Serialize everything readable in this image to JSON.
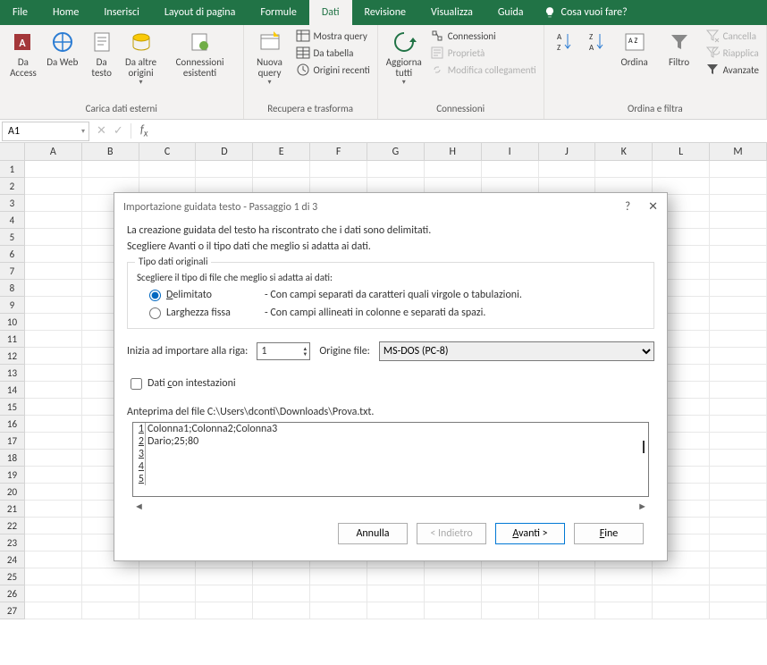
{
  "tabs": [
    "File",
    "Home",
    "Inserisci",
    "Layout di pagina",
    "Formule",
    "Dati",
    "Revisione",
    "Visualizza",
    "Guida"
  ],
  "active_tab": "Dati",
  "tell_me": "Cosa vuoi fare?",
  "ribbon": {
    "group1": {
      "label": "Carica dati esterni",
      "btns": [
        "Da Access",
        "Da Web",
        "Da testo",
        "Da altre origini",
        "Connessioni esistenti"
      ]
    },
    "group2": {
      "label": "Recupera e trasforma",
      "new_query": "Nuova query",
      "small": [
        "Mostra query",
        "Da tabella",
        "Origini recenti"
      ]
    },
    "group3": {
      "label": "Connessioni",
      "refresh": "Aggiorna tutti",
      "small": [
        "Connessioni",
        "Proprietà",
        "Modifica collegamenti"
      ]
    },
    "group4": {
      "label": "Ordina e filtra",
      "sort": "Ordina",
      "filter": "Filtro",
      "small": [
        "Cancella",
        "Riapplica",
        "Avanzate"
      ]
    }
  },
  "namebox": "A1",
  "cols": [
    "A",
    "B",
    "C",
    "D",
    "E",
    "F",
    "G",
    "H",
    "I",
    "J",
    "K",
    "L",
    "M"
  ],
  "rowcount": 27,
  "dialog": {
    "title": "Importazione guidata testo - Passaggio 1 di 3",
    "line1": "La creazione guidata del testo ha riscontrato che i dati sono delimitati.",
    "line2": "Scegliere Avanti o il tipo dati che meglio si adatta ai dati.",
    "fieldset": "Tipo dati originali",
    "fs_hint": "Scegliere il tipo di file che meglio si adatta ai dati:",
    "opt_delim": "Delimitato",
    "opt_delim_desc": "- Con campi separati da caratteri quali virgole o tabulazioni.",
    "opt_fixed": "Larghezza fissa",
    "opt_fixed_desc": "- Con campi allineati in colonne e separati da spazi.",
    "start_row_label": "Inizia ad importare alla riga:",
    "start_row": "1",
    "origin_label": "Origine file:",
    "origin": "MS-DOS (PC-8)",
    "headers_chk": "Dati con intestazioni",
    "preview_label": "Anteprima del file C:\\Users\\dconti\\Downloads\\Prova.txt.",
    "preview_lines": [
      "Colonna1;Colonna2;Colonna3",
      "Dario;25;80",
      "",
      "",
      ""
    ],
    "btn_cancel": "Annulla",
    "btn_back": "< Indietro",
    "btn_next": "Avanti >",
    "btn_finish": "Fine"
  }
}
